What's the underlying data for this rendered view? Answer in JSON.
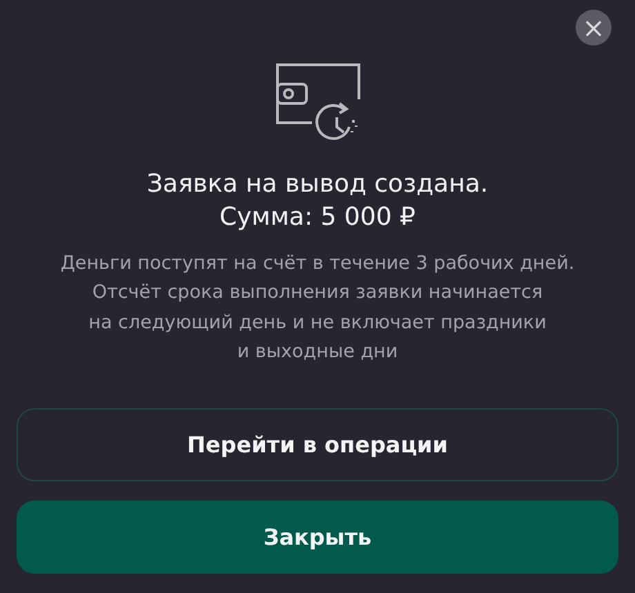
{
  "dialog": {
    "close_label": "×",
    "title_lines": [
      "Заявка на вывод создана.",
      "Сумма: 5 000 ₽"
    ],
    "message_lines": [
      "Деньги поступят на счёт в течение 3 рабочих дней.",
      "Отсчёт срока выполнения заявки начинается",
      "на следующий день и не включает праздники",
      "и выходные дни"
    ],
    "buttons": [
      {
        "label": "Перейти в операции",
        "kind": "outline"
      },
      {
        "label": "Закрыть",
        "kind": "primary"
      }
    ]
  }
}
